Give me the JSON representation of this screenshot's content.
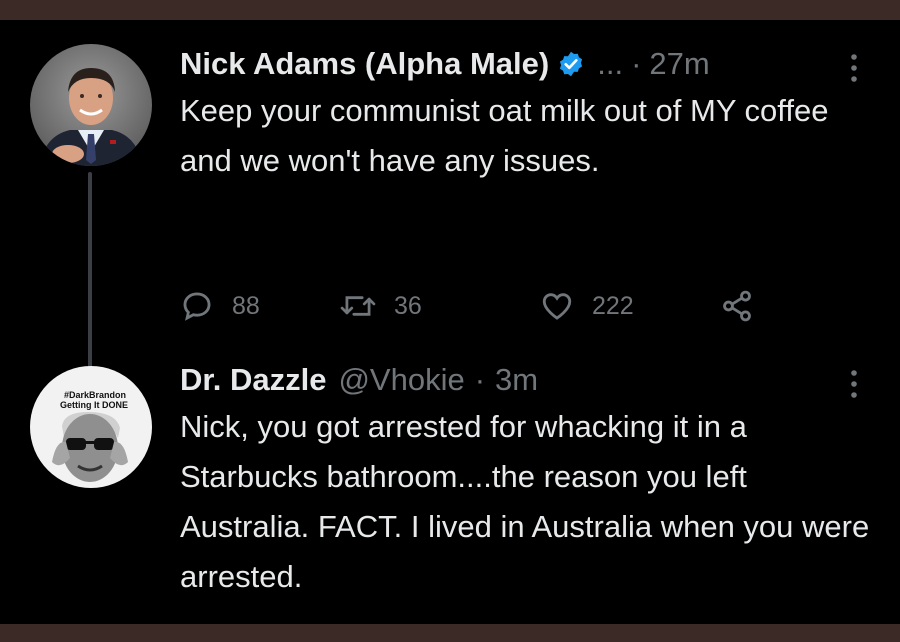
{
  "tweets": [
    {
      "display_name": "Nick Adams (Alpha Male)",
      "verified": true,
      "truncation": "...",
      "time": "27m",
      "text": "Keep your communist oat milk out of MY coffee and we won't have any issues.",
      "actions": {
        "replies": "88",
        "retweets": "36",
        "likes": "222"
      }
    },
    {
      "display_name": "Dr. Dazzle",
      "handle": "@Vhokie",
      "time": "3m",
      "text": "Nick, you got arrested for whacking it in a Starbucks bathroom....the reason you left Australia. FACT. I lived in Australia when you were arrested.",
      "avatar_text": [
        "#DarkBrandon",
        "Getting It DONE"
      ]
    }
  ],
  "separator": "·",
  "colors": {
    "background": "#000000",
    "frame": "#3b2a25",
    "text": "#e7e9ea",
    "muted": "#71767b",
    "verified": "#1d9bf0",
    "thread_line": "#3b3f45"
  },
  "icons": {
    "reply": "speech-bubble",
    "retweet": "retweet-arrows",
    "like": "heart-outline",
    "share": "share-nodes",
    "more": "vertical-ellipsis",
    "verified": "verified-badge"
  }
}
